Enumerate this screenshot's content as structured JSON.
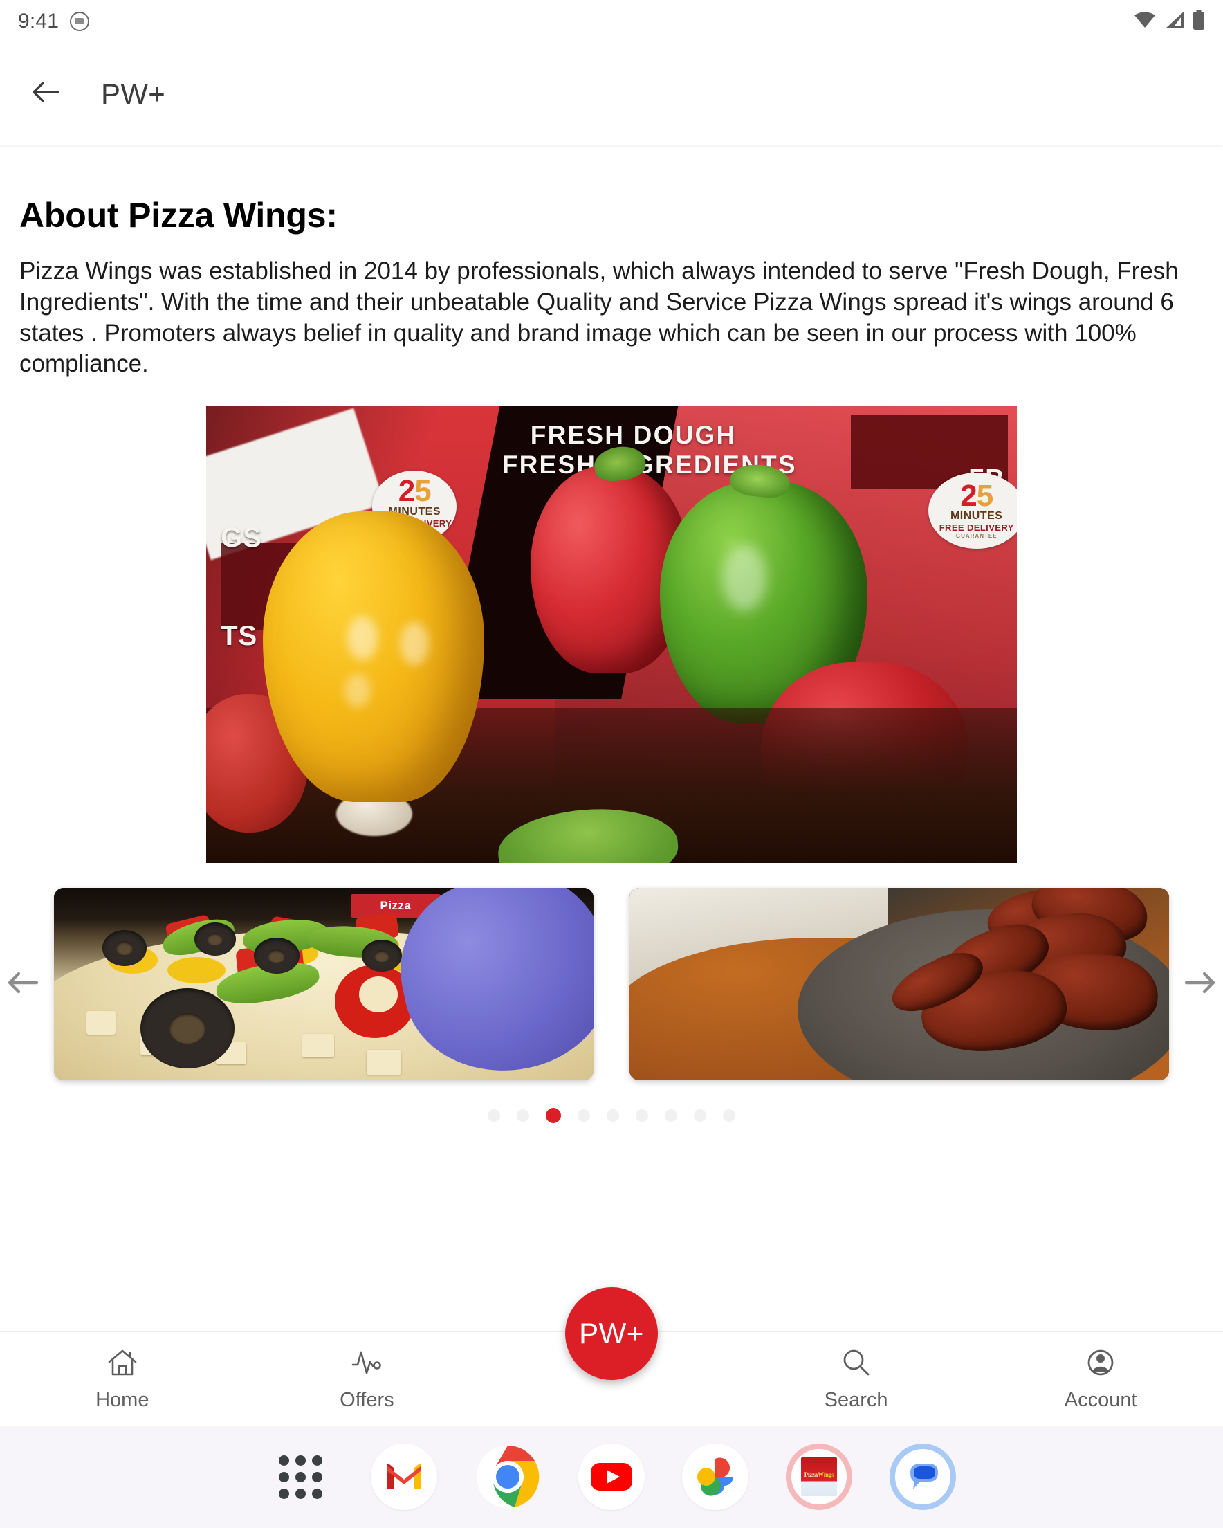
{
  "status_bar": {
    "time": "9:41",
    "notification_icon": "app-notification-icon",
    "wifi_icon": "wifi-icon",
    "signal_icon": "cellular-signal-icon",
    "battery_icon": "battery-full-icon"
  },
  "app_bar": {
    "back_icon": "back-arrow-icon",
    "title": "PW+"
  },
  "main": {
    "section_title": "About Pizza Wings:",
    "about_text": "Pizza Wings was established in 2014 by professionals, which always intended to serve \"Fresh Dough, Fresh Ingredients\". With the time and their unbeatable Quality and Service Pizza Wings spread it's wings around 6 states . Promoters always belief in quality and brand image which can be seen in our process with 100% compliance."
  },
  "hero_image": {
    "alt": "pizza-boxes-with-bell-peppers",
    "box_text_line1": "FRESH DOUGH",
    "box_text_line2": "FRESH INGREDIENTS",
    "box_text_partial_left_1": "GS",
    "box_text_partial_left_2": "TS",
    "box_text_partial_right": "FR",
    "badge_number_2": "2",
    "badge_number_5": "5",
    "badge_label_1": "MINUTES",
    "badge_label_2": "FREE DELIVERY",
    "badge_label_3": "GUARANTEE"
  },
  "carousel": {
    "prev_icon": "arrow-left-icon",
    "next_icon": "arrow-right-icon",
    "slides": [
      {
        "alt": "pizza-topped-with-peppers-olives-and-corn"
      },
      {
        "alt": "chicken-wings-on-plate"
      }
    ],
    "dot_count": 9,
    "active_dot_index": 2,
    "active_dot_color": "#dc1f26",
    "inactive_dot_color": "#f1f1f1"
  },
  "bottom_nav": {
    "items": [
      {
        "label": "Home",
        "icon": "home-icon"
      },
      {
        "label": "Offers",
        "icon": "pulse-activity-icon"
      },
      {
        "label": "Search",
        "icon": "search-icon"
      },
      {
        "label": "Account",
        "icon": "account-circle-icon"
      }
    ],
    "fab": {
      "label": "PW+",
      "color": "#dc1f26"
    }
  },
  "dock": {
    "items": [
      {
        "name": "app-drawer-icon",
        "label": "App drawer"
      },
      {
        "name": "gmail-icon",
        "label": "Gmail"
      },
      {
        "name": "chrome-icon",
        "label": "Chrome"
      },
      {
        "name": "youtube-icon",
        "label": "YouTube"
      },
      {
        "name": "google-photos-icon",
        "label": "Photos"
      },
      {
        "name": "pizza-wings-app-icon",
        "label": "Pizza Wings"
      },
      {
        "name": "google-messages-icon",
        "label": "Messages"
      }
    ],
    "pizza_wings_icon_text_1": "Pizza",
    "pizza_wings_icon_text_2": "Wings"
  }
}
